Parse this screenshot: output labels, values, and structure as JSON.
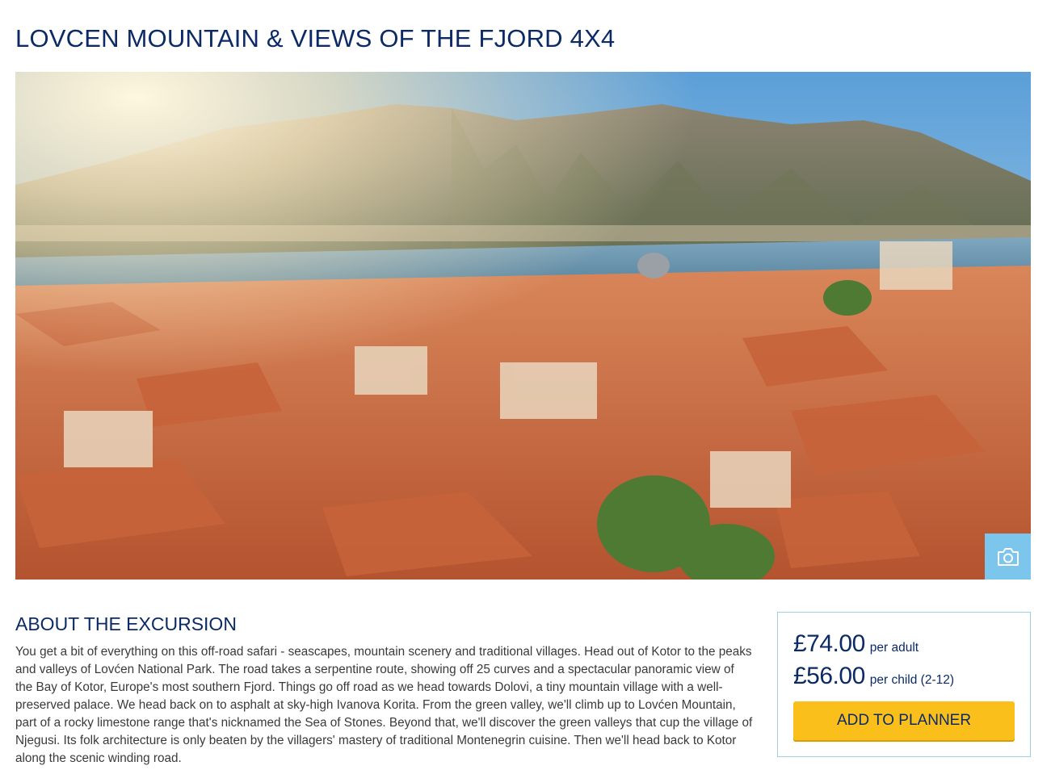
{
  "page": {
    "title": "LOVCEN MOUNTAIN & VIEWS OF THE FJORD 4X4"
  },
  "hero": {
    "gallery_icon": "camera-icon"
  },
  "about": {
    "heading": "ABOUT THE EXCURSION",
    "body": "You get a bit of everything on this off-road safari - seascapes, mountain scenery and traditional villages. Head out of Kotor to the peaks and valleys of Lovćen National Park. The road takes a serpentine route, showing off 25 curves and a spectacular panoramic view of the Bay of Kotor, Europe's most southern Fjord. Things go off road as we head towards Dolovi, a tiny mountain village with a well-preserved palace. We head back on to asphalt at sky-high Ivanova Korita. From the green valley, we'll climb up to Lovćen Mountain, part of a rocky limestone range that's nicknamed the Sea of Stones. Beyond that, we'll discover the green valleys that cup the village of Njegusi. Its folk architecture is only beaten by the villagers' mastery of traditional Montenegrin cuisine.  Then we'll head back to Kotor along the scenic winding road."
  },
  "pricing": {
    "adult_price": "£74.00",
    "adult_label": "per adult",
    "child_price": "£56.00",
    "child_label": "per child (2-12)",
    "add_button_label": "ADD TO PLANNER"
  },
  "colors": {
    "title": "#0b2a66",
    "accent_button": "#fbbf1b",
    "camera_button": "#7cc6ee",
    "price_box_border": "#9fd0ea"
  }
}
